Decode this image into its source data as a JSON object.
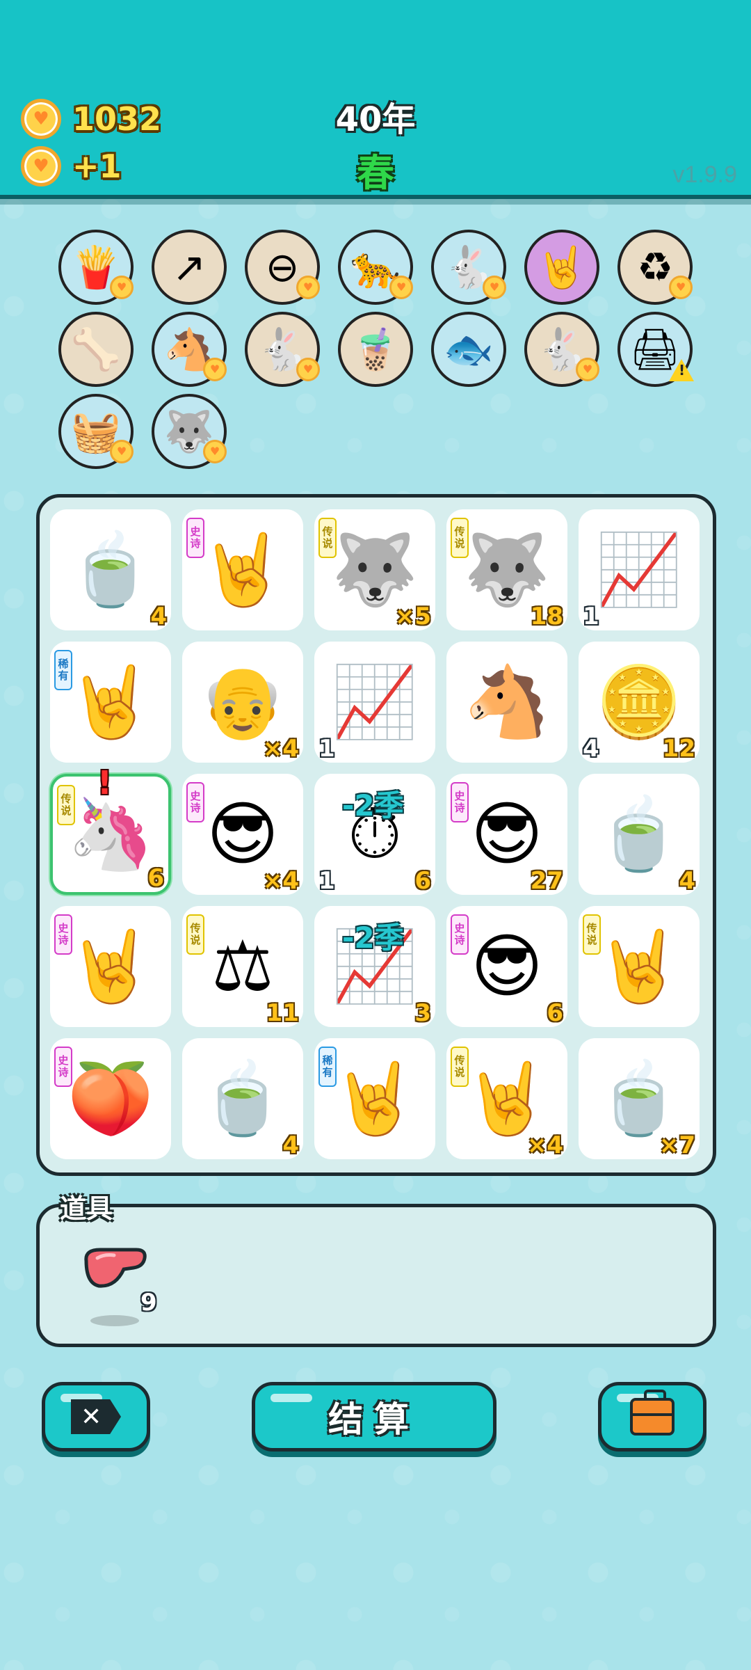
{
  "header": {
    "coins": "1032",
    "coin_gain": "+1",
    "year": "40年",
    "season": "春",
    "version": "v1.9.9",
    "coin_icon": "heart-coin-icon"
  },
  "symbols": [
    {
      "icon": "🍟",
      "name": "fries-icon",
      "bg": "blue",
      "badge": "coin"
    },
    {
      "icon": "↗",
      "name": "arrow-card-icon",
      "bg": "beige",
      "badge": ""
    },
    {
      "icon": "⊖",
      "name": "minus-icon",
      "bg": "beige",
      "badge": "coin"
    },
    {
      "icon": "🐆",
      "name": "cheetah-icon",
      "bg": "blue",
      "badge": "coin"
    },
    {
      "icon": "🐇",
      "name": "rabbit-icon",
      "bg": "blue",
      "badge": "coin"
    },
    {
      "icon": "🤘",
      "name": "rock-hand-icon",
      "bg": "purple",
      "badge": ""
    },
    {
      "icon": "♻",
      "name": "recycle-icon",
      "bg": "beige",
      "badge": "coin"
    },
    {
      "icon": "🦴",
      "name": "dog-food-icon",
      "bg": "beige",
      "badge": ""
    },
    {
      "icon": "🐴",
      "name": "horse-pair-icon",
      "bg": "blue",
      "badge": "coin"
    },
    {
      "icon": "🐇",
      "name": "rabbit-icon",
      "bg": "beige",
      "badge": "coin"
    },
    {
      "icon": "🧋",
      "name": "bubble-tea-icon",
      "bg": "beige",
      "badge": ""
    },
    {
      "icon": "🐟",
      "name": "fish-tank-icon",
      "bg": "blue",
      "badge": ""
    },
    {
      "icon": "🐇",
      "name": "rabbit-icon",
      "bg": "beige",
      "badge": "coin"
    },
    {
      "icon": "🖨",
      "name": "printer-icon",
      "bg": "blue",
      "badge": "warn"
    },
    {
      "icon": "🧺",
      "name": "fruit-basket-icon",
      "bg": "blue",
      "badge": "coin"
    },
    {
      "icon": "🐺",
      "name": "husky-icon",
      "bg": "blue",
      "badge": "coin"
    }
  ],
  "tags": {
    "epic": "史诗",
    "legend": "传说",
    "rare": "稀有"
  },
  "board": [
    {
      "icon": "🍵",
      "name": "tea-bowl-icon",
      "tag": "",
      "right": "4",
      "left": ""
    },
    {
      "icon": "🤘",
      "name": "rock-hand-icon",
      "tag": "epic",
      "right": "",
      "left": ""
    },
    {
      "icon": "🐺",
      "name": "husky-king-icon",
      "tag": "legend",
      "right": "×5",
      "left": ""
    },
    {
      "icon": "🐺",
      "name": "husky-king-icon",
      "tag": "legend",
      "right": "18",
      "left": ""
    },
    {
      "icon": "📈",
      "name": "trend-card-icon",
      "tag": "",
      "right": "",
      "left": "1"
    },
    {
      "icon": "🤘",
      "name": "rock-hand-icon",
      "tag": "rare",
      "right": "",
      "left": ""
    },
    {
      "icon": "👴",
      "name": "old-man-icon",
      "tag": "",
      "right": "×4",
      "left": ""
    },
    {
      "icon": "📈",
      "name": "trend-card-icon",
      "tag": "",
      "right": "",
      "left": "1"
    },
    {
      "icon": "🐴",
      "name": "horse-icon",
      "tag": "",
      "right": "",
      "left": ""
    },
    {
      "icon": "🪙",
      "name": "gold-bars-icon",
      "tag": "",
      "right": "12",
      "left": "4"
    },
    {
      "icon": "🦄",
      "name": "unicorn-icon",
      "tag": "legend",
      "right": "6",
      "left": "",
      "selected": true
    },
    {
      "icon": "😎",
      "name": "green-hair-guy-icon",
      "tag": "epic",
      "right": "×4",
      "left": ""
    },
    {
      "icon": "⏱",
      "name": "season-timer-icon",
      "tag": "",
      "right": "6",
      "left": "1",
      "overlay": "-2季"
    },
    {
      "icon": "😎",
      "name": "green-hair-guy-icon",
      "tag": "epic",
      "right": "27",
      "left": ""
    },
    {
      "icon": "🍵",
      "name": "tea-bowl-icon",
      "tag": "",
      "right": "4",
      "left": ""
    },
    {
      "icon": "🤘",
      "name": "rock-hand-icon",
      "tag": "epic",
      "right": "",
      "left": ""
    },
    {
      "icon": "⚖",
      "name": "scales-icon",
      "tag": "legend",
      "right": "11",
      "left": ""
    },
    {
      "icon": "📈",
      "name": "trend-card-icon",
      "tag": "",
      "right": "3",
      "left": "",
      "overlay": "-2季"
    },
    {
      "icon": "😎",
      "name": "green-hair-guy-icon",
      "tag": "epic",
      "right": "6",
      "left": ""
    },
    {
      "icon": "🤘",
      "name": "rock-hand-icon",
      "tag": "legend",
      "right": "",
      "left": ""
    },
    {
      "icon": "🍑",
      "name": "peach-icon",
      "tag": "epic",
      "right": "",
      "left": ""
    },
    {
      "icon": "🍵",
      "name": "tea-bowl-icon",
      "tag": "",
      "right": "4",
      "left": ""
    },
    {
      "icon": "🤘",
      "name": "rock-hand-icon",
      "tag": "rare",
      "right": "",
      "left": ""
    },
    {
      "icon": "🤘",
      "name": "rock-hand-icon",
      "tag": "legend",
      "right": "×4",
      "left": ""
    },
    {
      "icon": "🍵",
      "name": "tea-bowl-icon",
      "tag": "",
      "right": "×7",
      "left": ""
    }
  ],
  "alert": "!",
  "items": {
    "title": "道具",
    "entries": [
      {
        "icon": "liver-icon",
        "count": "9"
      }
    ]
  },
  "buttons": {
    "delete_icon": "delete-key-icon",
    "delete_glyph": "✕",
    "settle_label": "结算",
    "bag_icon": "briefcase-icon"
  }
}
